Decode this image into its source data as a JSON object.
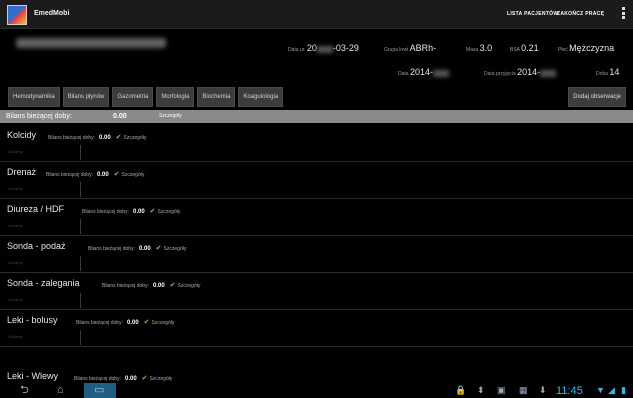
{
  "app": {
    "title": "EmedMobi",
    "icon": "app-logo-icon"
  },
  "actionbar": {
    "patients_link": "LISTA PACJENTÓW",
    "rounds_link": "ZAKOŃCZ PRACĘ",
    "overflow_icon": "overflow-menu-icon"
  },
  "patient": {
    "row1": [
      {
        "label": "Data ur.",
        "value_start": "20",
        "value_end": "-03-29"
      },
      {
        "label": "Grupa krwi",
        "value": "ABRh-"
      },
      {
        "label": "Masa",
        "value": "3.0"
      },
      {
        "label": "BSA",
        "value": "0.21"
      },
      {
        "label": "Płeć",
        "value": "Mężczyzna"
      }
    ],
    "row2": [
      {
        "label": "Data",
        "value": "2014-"
      },
      {
        "label": "Data przyjęcia",
        "value": "2014-"
      },
      {
        "label": "Doba",
        "value": "14"
      }
    ]
  },
  "tabs": [
    "Hemodynamika",
    "Bilans płynów",
    "Gazometria",
    "Morfologia",
    "Biochemia",
    "Koagulologia"
  ],
  "add_observation": "Dodaj obserwacje",
  "balance_bar": {
    "label": "Bilans bieżącej doby:",
    "value": "0.00",
    "details": "Szczegóły"
  },
  "sections": [
    {
      "title": "Kolcidy",
      "sub": "Bilans bieżącej doby:",
      "value": "0.00",
      "details": "Szczegóły",
      "foot": "Godziny"
    },
    {
      "title": "Drenaż",
      "sub": "Bilans bieżącej doby:",
      "value": "0.00",
      "details": "Szczegóły",
      "foot": "Godziny"
    },
    {
      "title": "Diureza / HDF",
      "sub": "Bilans bieżącej doby:",
      "value": "0.00",
      "details": "Szczegóły",
      "foot": "Godziny"
    },
    {
      "title": "Sonda - podaż",
      "sub": "Bilans bieżącej doby:",
      "value": "0.00",
      "details": "Szczegóły",
      "foot": "Godziny"
    },
    {
      "title": "Sonda - zalegania",
      "sub": "Bilans bieżącej doby:",
      "value": "0.00",
      "details": "Szczegóły",
      "foot": "Godziny"
    },
    {
      "title": "Leki - bolusy",
      "sub": "Bilans bieżącej doby:",
      "value": "0.00",
      "details": "Szczegóły",
      "foot": "Godziny"
    },
    {
      "title": "Leki - Wlewy",
      "sub": "Bilans bieżącej doby:",
      "value": "0.00",
      "details": "Szczegóły",
      "foot": ""
    }
  ],
  "navbar": {
    "clock": "11:45"
  },
  "colors": {
    "accent": "#33b5e5",
    "balance_bar": "#8a8a8a",
    "check": "#66cc44"
  }
}
